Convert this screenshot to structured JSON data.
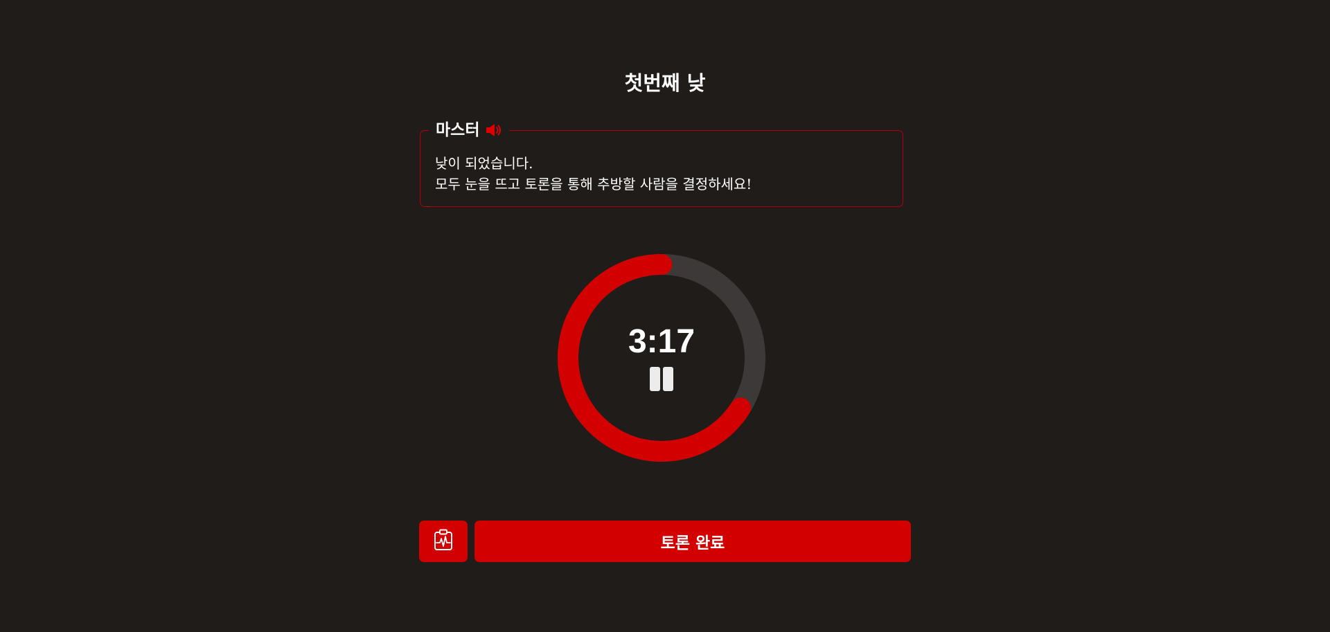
{
  "title": "첫번째 낮",
  "master": {
    "name": "마스터",
    "speaker_icon": "speaker-icon",
    "messages": [
      "낮이 되었습니다.",
      "모두 눈을 뜨고 토론을 통해 추방할 사람을 결정하세요!"
    ]
  },
  "timer": {
    "display": "3:17",
    "progress_remaining": 0.66,
    "state": "running",
    "control_icon": "pause-icon"
  },
  "actions": {
    "report_icon": "clipboard-pulse-icon",
    "finish_label": "토론 완료"
  },
  "colors": {
    "background": "#201c1a",
    "accent": "#d20000",
    "ring_track": "#3d3938",
    "border": "#b3000c"
  }
}
